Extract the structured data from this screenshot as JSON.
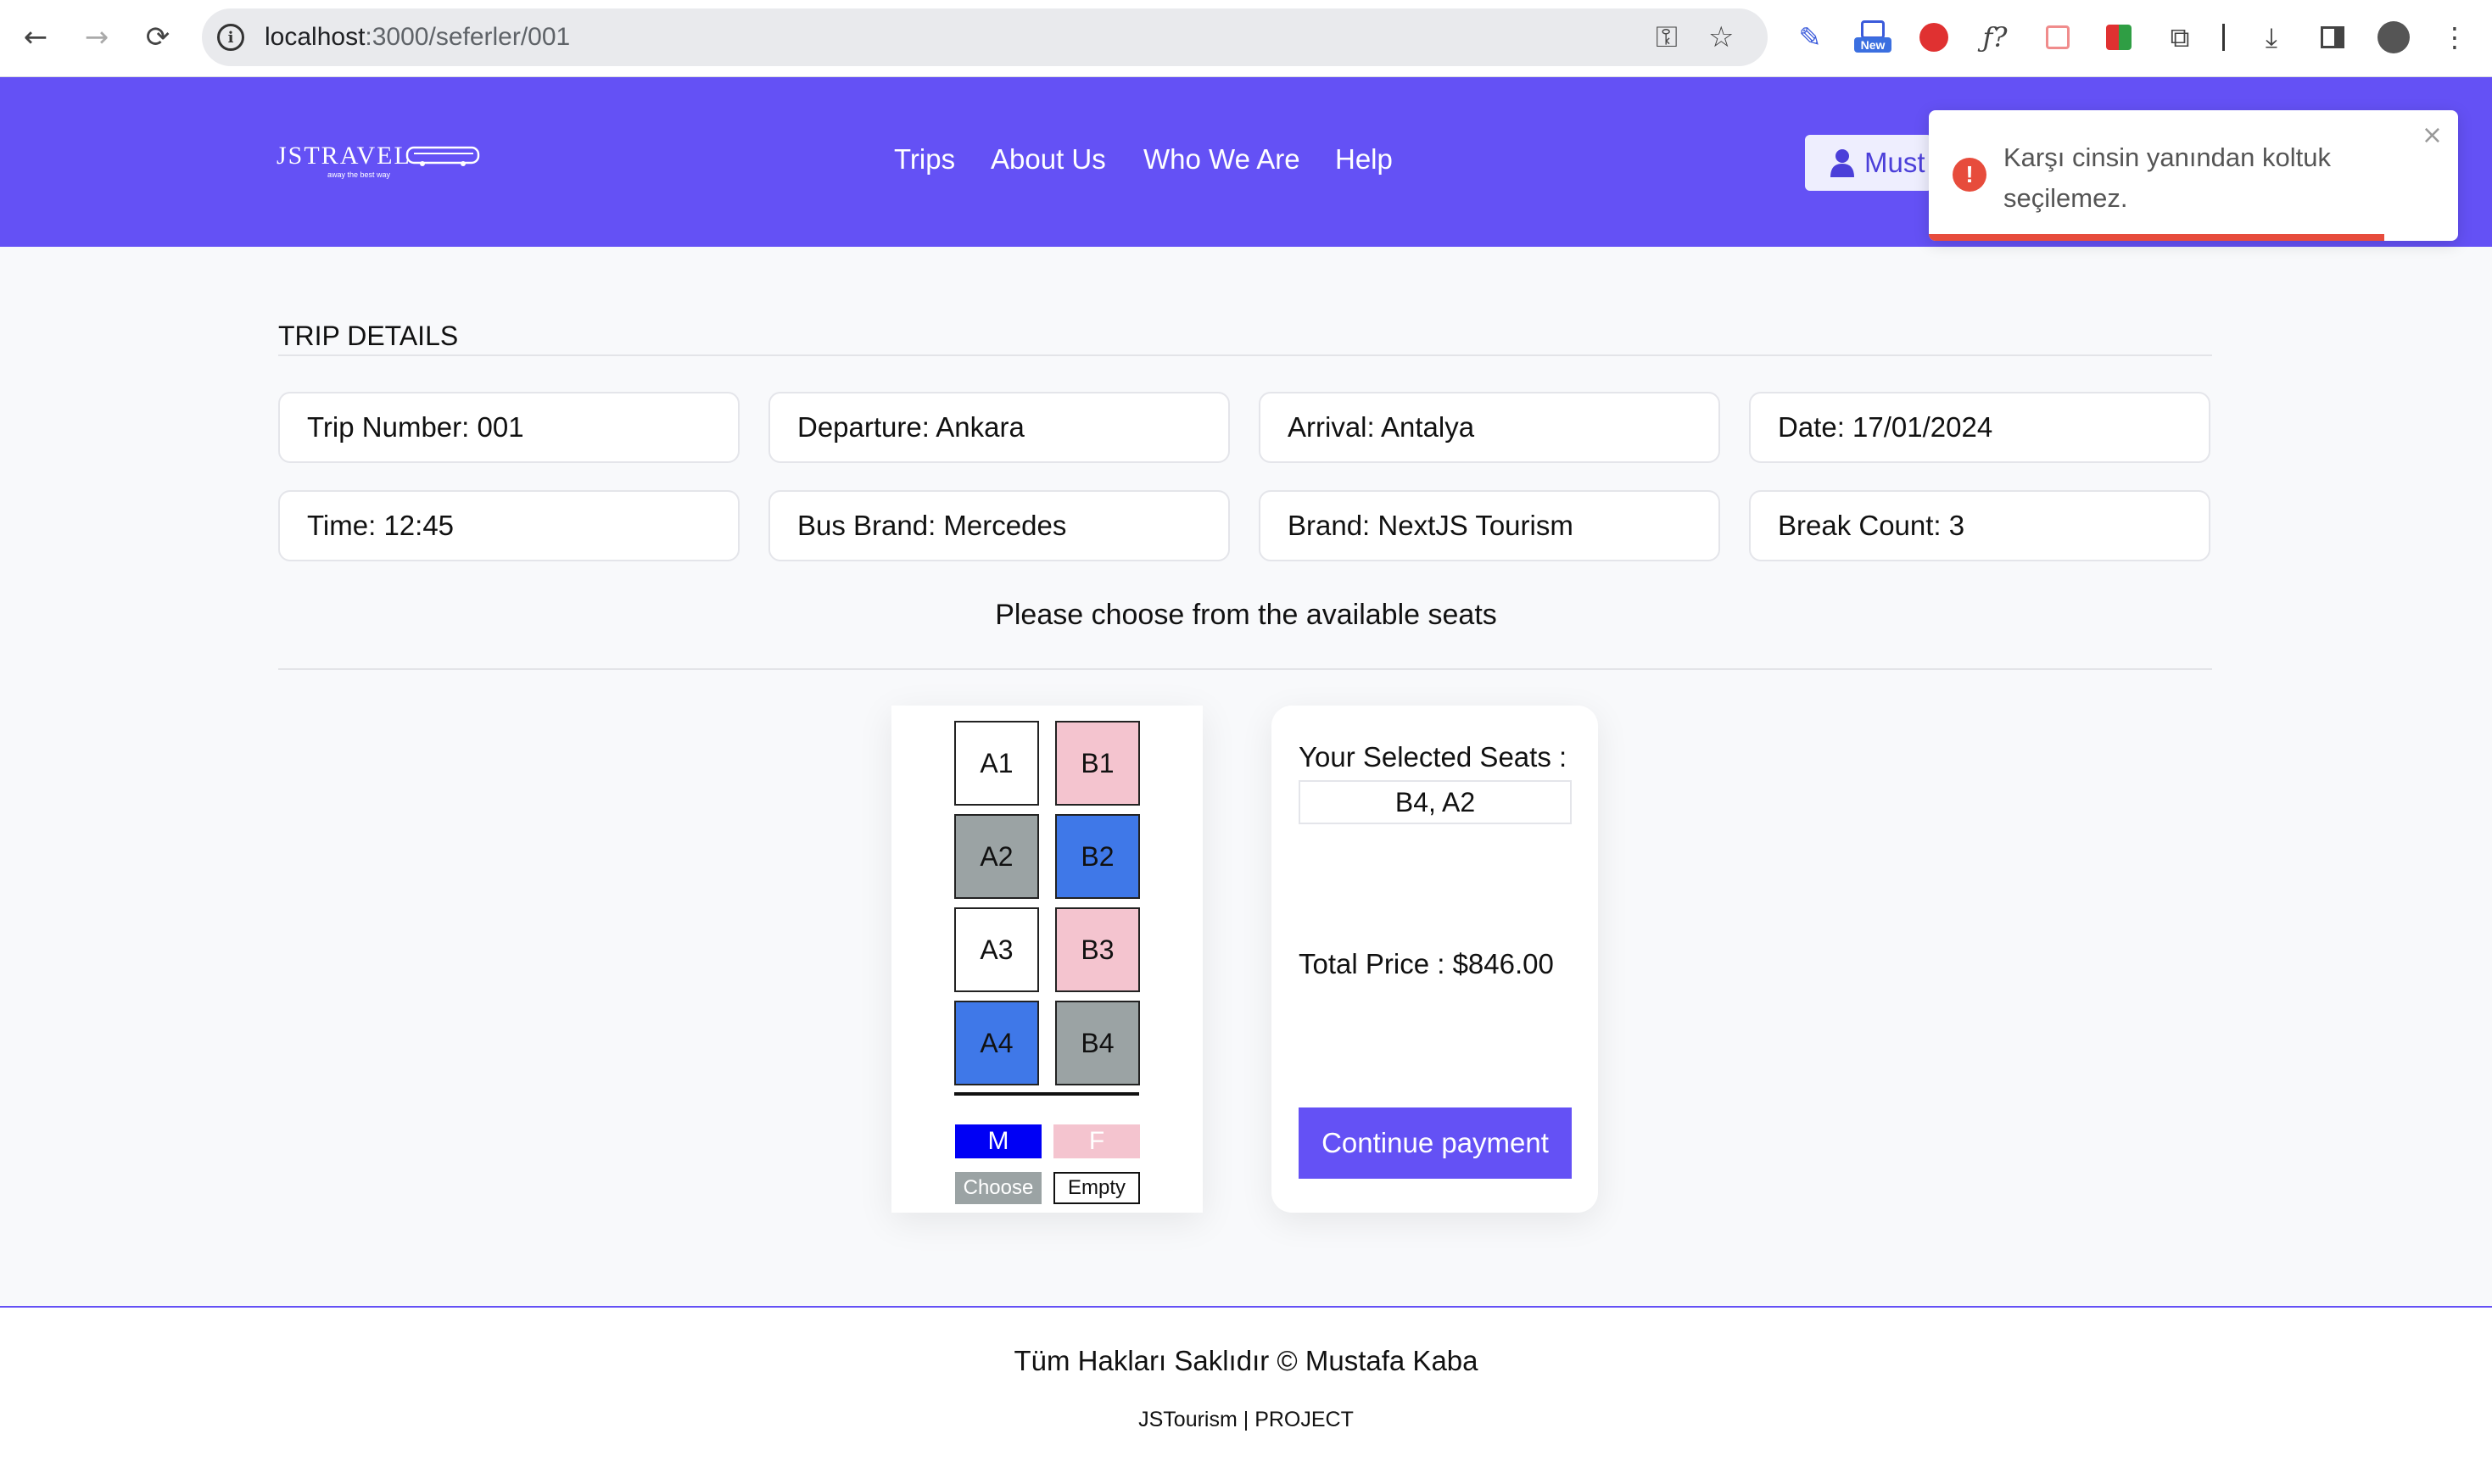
{
  "browser": {
    "url_host": "localhost",
    "url_rest": ":3000/seferler/001",
    "ext_badge": "New"
  },
  "header": {
    "logo": "JSTRAVEL",
    "logo_sub": "away the best way",
    "menu": [
      "Trips",
      "About Us",
      "Who We Are",
      "Help"
    ],
    "user_label": "Must"
  },
  "toast": {
    "message": "Karşı cinsin yanından koltuk seçilemez.",
    "close": "×",
    "type": "error",
    "progress": 0.86
  },
  "trip": {
    "section_title": "TRIP DETAILS",
    "cards": [
      "Trip Number: 001",
      "Departure: Ankara",
      "Arrival: Antalya",
      "Date: 17/01/2024",
      "Time: 12:45",
      "Bus Brand: Mercedes",
      "Brand: NextJS Tourism",
      "Break Count: 3"
    ],
    "choose_text": "Please choose from the available seats"
  },
  "seats": [
    {
      "id": "A1",
      "status": "empty"
    },
    {
      "id": "B1",
      "status": "female"
    },
    {
      "id": "A2",
      "status": "chosen"
    },
    {
      "id": "B2",
      "status": "male"
    },
    {
      "id": "A3",
      "status": "empty"
    },
    {
      "id": "B3",
      "status": "female"
    },
    {
      "id": "A4",
      "status": "male"
    },
    {
      "id": "B4",
      "status": "chosen"
    }
  ],
  "legend": {
    "male": "M",
    "female": "F",
    "choose": "Choose",
    "empty": "Empty"
  },
  "summary": {
    "selected_label": "Your Selected Seats :",
    "selected_value": "B4, A2",
    "total": "Total Price : $846.00",
    "pay_button": "Continue payment"
  },
  "footer": {
    "main": "Tüm Hakları Saklıdır © Mustafa Kaba",
    "sub": "JSTourism | PROJECT"
  },
  "colors": {
    "brand": "#6451f5",
    "male": "#3f78e8",
    "female": "#f4c4cf",
    "chosen": "#9ba3a4",
    "error": "#e74c3c"
  }
}
